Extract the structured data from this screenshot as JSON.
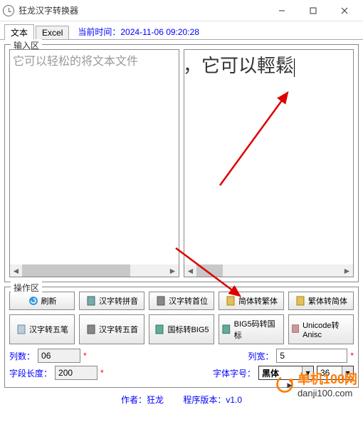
{
  "window": {
    "title": "狂龙汉字转换器"
  },
  "tabs": {
    "text": "文本",
    "excel": "Excel"
  },
  "timestamp_label": "当前时间：",
  "timestamp_value": "2024-11-06  09:20:28",
  "input_area": {
    "legend": "输入区",
    "left_text": "它可以轻松的将文本文件",
    "right_text": "牛，它可以輕鬆"
  },
  "ops": {
    "legend": "操作区",
    "row1": {
      "b1": "刷新",
      "b2": "汉字转拼音",
      "b3": "汉字转首位",
      "b4": "简体转繁体",
      "b5": "繁体转简体"
    },
    "row2": {
      "b1": "汉字转五笔",
      "b2": "汉字转五首",
      "b3": "国标转BIG5",
      "b4": "BIG5码转国标",
      "b5": "Unicode转Anisc"
    },
    "cols_label": "列数：",
    "cols_value": "06",
    "width_label": "列宽：",
    "width_value": "5",
    "fieldlen_label": "字段长度：",
    "fieldlen_value": "200",
    "font_label": "字体字号：",
    "font_name": "黑体",
    "font_size": "36"
  },
  "footer": {
    "author": "作者：狂龙",
    "version": "程序版本：v1.0"
  },
  "watermark": {
    "main": "单机100网",
    "sub": "danji100.com"
  }
}
